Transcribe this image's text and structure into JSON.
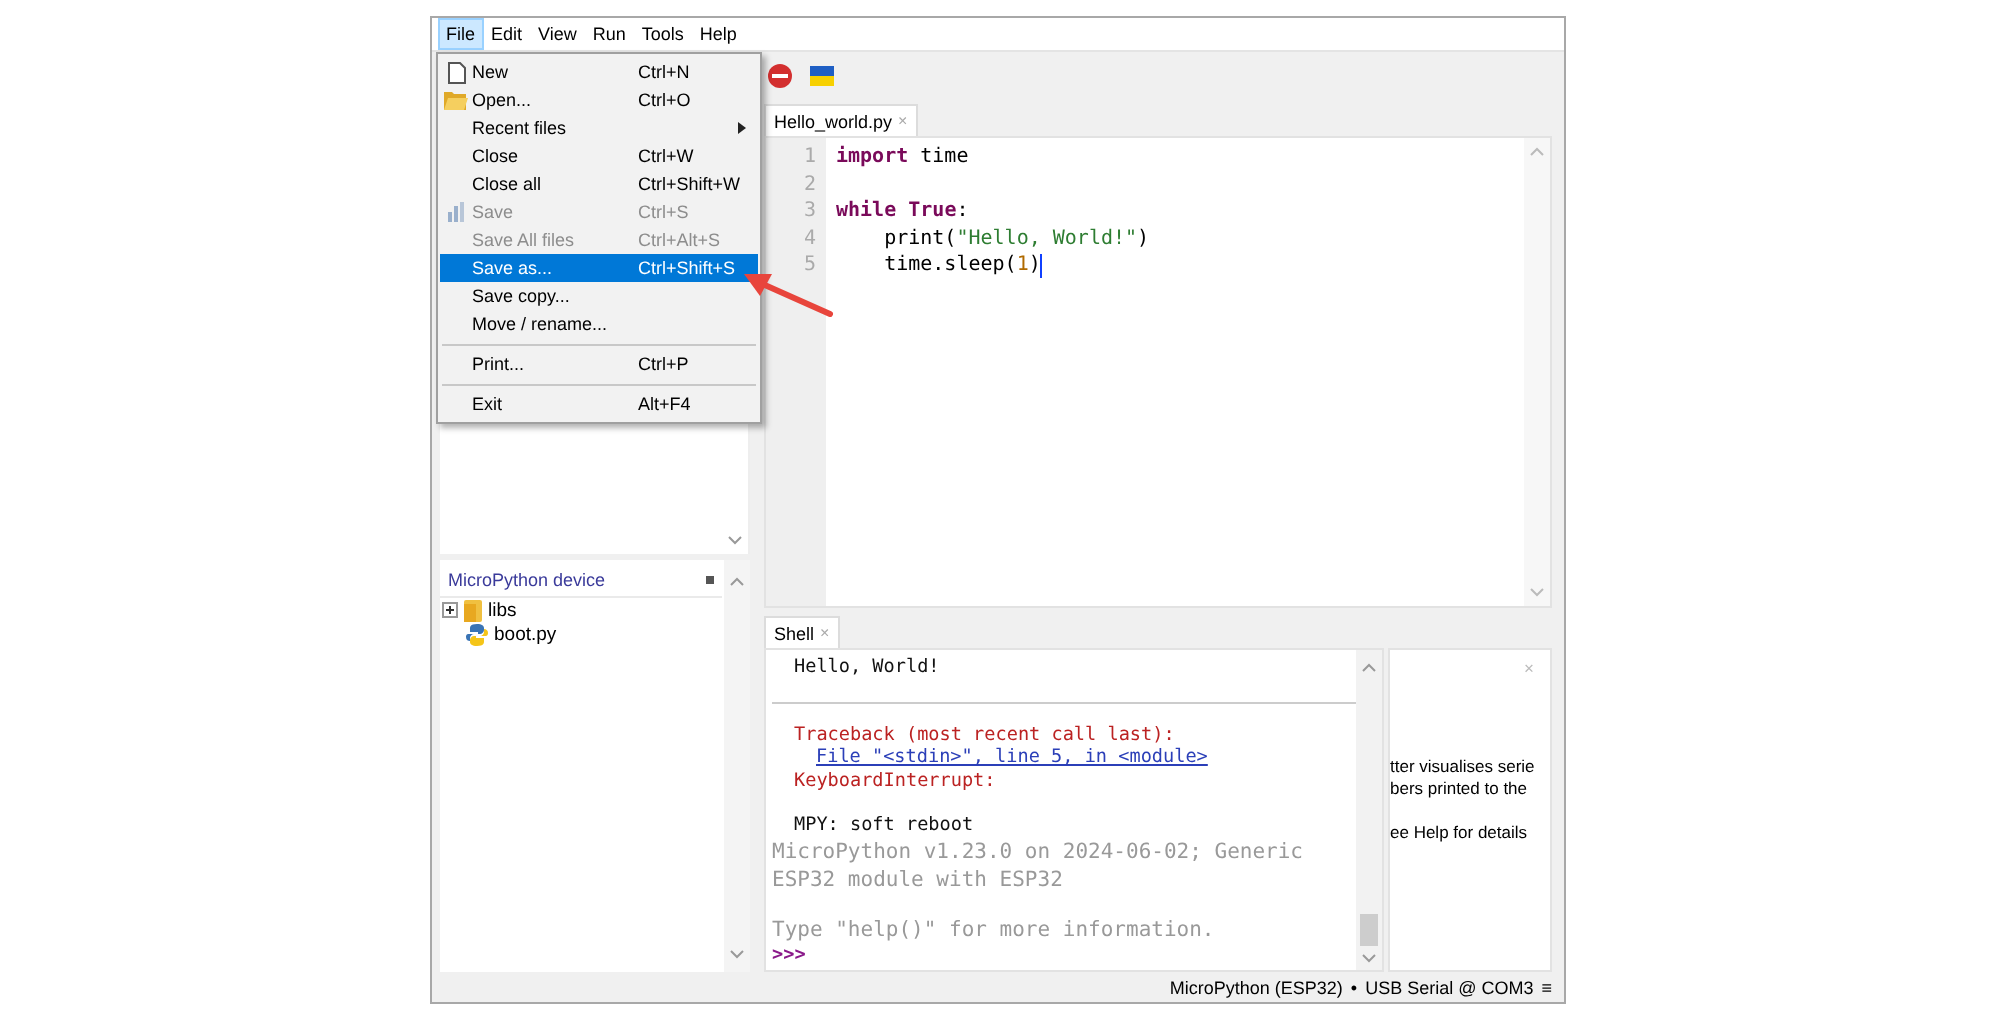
{
  "menubar": [
    {
      "label": "File",
      "selected": true
    },
    {
      "label": "Edit",
      "selected": false
    },
    {
      "label": "View",
      "selected": false
    },
    {
      "label": "Run",
      "selected": false
    },
    {
      "label": "Tools",
      "selected": false
    },
    {
      "label": "Help",
      "selected": false
    }
  ],
  "file_menu": [
    {
      "kind": "item",
      "label": "New",
      "shortcut": "Ctrl+N",
      "disabled": false,
      "selected": false,
      "submenu": false
    },
    {
      "kind": "item",
      "label": "Open...",
      "shortcut": "Ctrl+O",
      "disabled": false,
      "selected": false,
      "submenu": false
    },
    {
      "kind": "item",
      "label": "Recent files",
      "disabled": false,
      "selected": false,
      "submenu": true
    },
    {
      "kind": "item",
      "label": "Close",
      "shortcut": "Ctrl+W",
      "disabled": false,
      "selected": false,
      "submenu": false
    },
    {
      "kind": "item",
      "label": "Close all",
      "shortcut": "Ctrl+Shift+W",
      "disabled": false,
      "selected": false,
      "submenu": false
    },
    {
      "kind": "item",
      "label": "Save",
      "shortcut": "Ctrl+S",
      "disabled": true,
      "selected": false,
      "submenu": false
    },
    {
      "kind": "item",
      "label": "Save All files",
      "shortcut": "Ctrl+Alt+S",
      "disabled": true,
      "selected": false,
      "submenu": false
    },
    {
      "kind": "item",
      "label": "Save as...",
      "shortcut": "Ctrl+Shift+S",
      "disabled": false,
      "selected": true,
      "submenu": false
    },
    {
      "kind": "item",
      "label": "Save copy...",
      "disabled": false,
      "selected": false,
      "submenu": false
    },
    {
      "kind": "item",
      "label": "Move / rename...",
      "disabled": false,
      "selected": false,
      "submenu": false
    },
    {
      "kind": "separator"
    },
    {
      "kind": "item",
      "label": "Print...",
      "shortcut": "Ctrl+P",
      "disabled": false,
      "selected": false,
      "submenu": false
    },
    {
      "kind": "separator"
    },
    {
      "kind": "item",
      "label": "Exit",
      "shortcut": "Alt+F4",
      "disabled": false,
      "selected": false,
      "submenu": false
    }
  ],
  "sidebar": {
    "device_panel": {
      "title": "MicroPython device",
      "tree": [
        {
          "kind": "folder",
          "label": "libs",
          "expanded": false
        },
        {
          "kind": "file",
          "label": "boot.py"
        }
      ]
    }
  },
  "editor": {
    "tab": {
      "label": "Hello_world.py",
      "close": "×",
      "selected": true
    },
    "lines": [
      {
        "number": "1",
        "cursor": false,
        "tokens": [
          {
            "kind": "keyword",
            "text": "import"
          },
          {
            "kind": "plain",
            "text": " time"
          }
        ]
      },
      {
        "number": "2",
        "cursor": false
      },
      {
        "number": "3",
        "cursor": false,
        "tokens": [
          {
            "kind": "keyword",
            "text": "while"
          },
          {
            "kind": "keyword",
            "text": " True"
          },
          {
            "kind": "plain",
            "text": ":"
          }
        ]
      },
      {
        "number": "4",
        "cursor": false,
        "tokens": [
          {
            "kind": "plain",
            "text": "    print("
          },
          {
            "kind": "string",
            "text": "\"Hello, World!\""
          },
          {
            "kind": "plain",
            "text": ")"
          }
        ]
      },
      {
        "number": "5",
        "cursor": true,
        "tokens": [
          {
            "kind": "plain",
            "text": "    time.sleep("
          },
          {
            "kind": "number",
            "text": "1"
          },
          {
            "kind": "plain",
            "text": ")"
          }
        ]
      }
    ]
  },
  "shell": {
    "tab": {
      "label": "Shell",
      "close": "×",
      "selected": true
    },
    "lines": [
      {
        "kind": "output",
        "text": "Hello, World!"
      },
      {
        "kind": "rule"
      },
      {
        "kind": "error",
        "text": "Traceback (most recent call last):"
      },
      {
        "kind": "link",
        "text": "File \"<stdin>\", line 5, in <module>"
      },
      {
        "kind": "error",
        "text": "KeyboardInterrupt:"
      },
      {
        "kind": "blank"
      },
      {
        "kind": "output",
        "text": "MPY: soft reboot"
      },
      {
        "kind": "banner",
        "text": "MicroPython v1.23.0 on 2024-06-02; Generic ESP32 module with ESP32"
      },
      {
        "kind": "blank"
      },
      {
        "kind": "banner",
        "text": "Type \"help()\" for more information."
      },
      {
        "kind": "prompt",
        "text": ">>>"
      }
    ]
  },
  "plotter": {
    "close": "×",
    "paragraphs": [
      [
        "tter visualises serie",
        "bers printed to the"
      ],
      [
        "ee Help for details"
      ]
    ]
  },
  "status_bar": {
    "interpreter": "MicroPython (ESP32)",
    "separator": "•",
    "port": "USB Serial @ COM3",
    "menu": "≡"
  }
}
